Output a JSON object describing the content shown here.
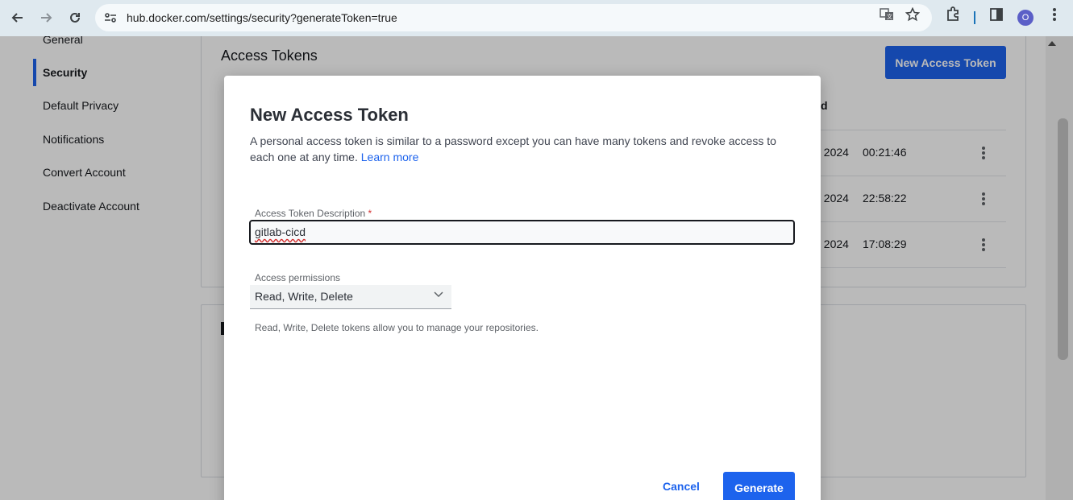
{
  "browser": {
    "url": "hub.docker.com/settings/security?generateToken=true",
    "profile_initial": "O"
  },
  "sidebar": {
    "items": [
      {
        "label": "General"
      },
      {
        "label": "Security",
        "active": true
      },
      {
        "label": "Default Privacy"
      },
      {
        "label": "Notifications"
      },
      {
        "label": "Convert Account"
      },
      {
        "label": "Deactivate Account"
      }
    ]
  },
  "main": {
    "heading": "Access Tokens",
    "new_token_button": "New Access Token",
    "column_header_partial": "d",
    "rows": [
      {
        "date_partial": ", 2024",
        "time": "00:21:46"
      },
      {
        "date_partial": ", 2024",
        "time": "22:58:22"
      },
      {
        "date_partial": ", 2024",
        "time": "17:08:29"
      }
    ]
  },
  "modal": {
    "title": "New Access Token",
    "description": "A personal access token is similar to a password except you can have many tokens and revoke access to each one at any time.",
    "learn_more": "Learn more",
    "description_label": "Access Token Description",
    "required_mark": "*",
    "description_value": "gitlab-cicd",
    "permissions_label": "Access permissions",
    "permissions_value": "Read, Write, Delete",
    "permissions_helper": "Read, Write, Delete tokens allow you to manage your repositories.",
    "cancel": "Cancel",
    "generate": "Generate"
  },
  "colors": {
    "accent": "#1d63ed",
    "overlay": "rgba(0,0,0,0.27)"
  }
}
